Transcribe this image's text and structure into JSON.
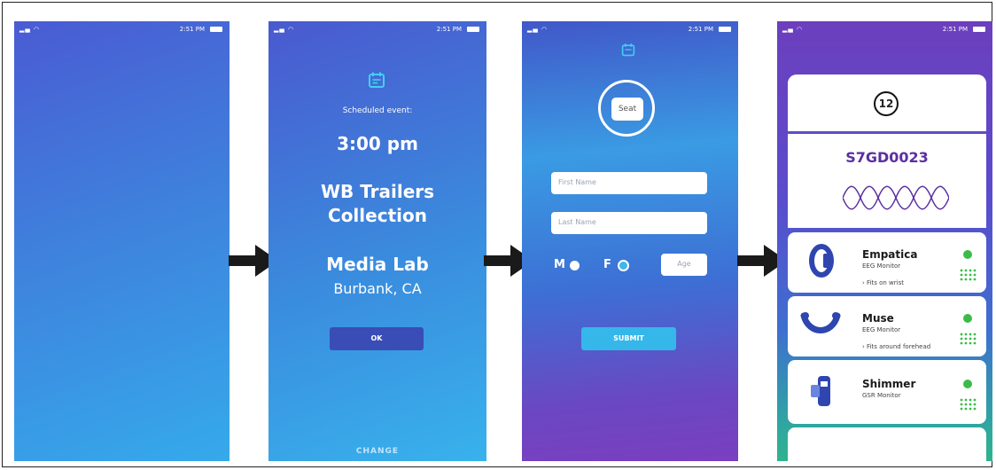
{
  "status": {
    "time": "2:51 PM"
  },
  "screen2": {
    "scheduled_label": "Scheduled event:",
    "time": "3:00 pm",
    "event_line1": "WB Trailers",
    "event_line2": "Collection",
    "venue": "Media Lab",
    "city": "Burbank, CA",
    "ok_label": "OK",
    "change_label": "CHANGE"
  },
  "screen3": {
    "seat_label": "Seat",
    "first_name_placeholder": "First Name",
    "last_name_placeholder": "Last Name",
    "gender_m": "M",
    "gender_f": "F",
    "age_placeholder": "Age",
    "submit_label": "SUBMIT"
  },
  "screen4": {
    "seat_number": "12",
    "session_id": "S7GD0023",
    "devices": [
      {
        "name": "Empatica",
        "type": "EEG Monitor",
        "note": "› Fits on wrist"
      },
      {
        "name": "Muse",
        "type": "EEG Monitor",
        "note": "› Fits around forehead"
      },
      {
        "name": "Shimmer",
        "type": "GSR Monitor",
        "note": ""
      }
    ]
  },
  "colors": {
    "accent_blue": "#3a4fc7",
    "button_cyan": "#35b7ea",
    "ok_button": "#3a4cb5",
    "green": "#3dbb4a",
    "purple": "#5b2fa0"
  }
}
